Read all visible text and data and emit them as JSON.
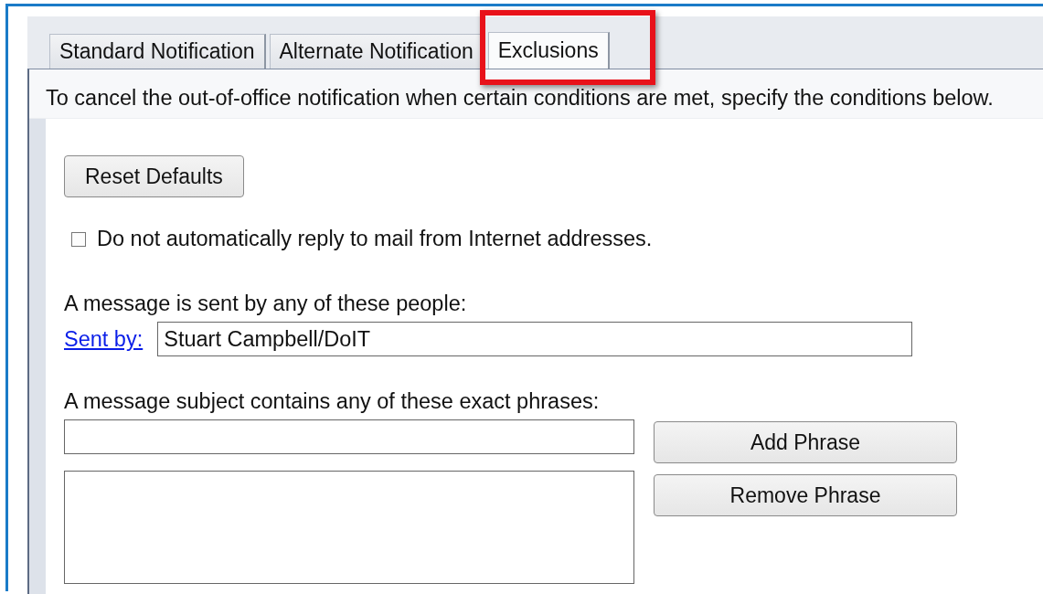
{
  "tabs": [
    {
      "label": "Standard Notification",
      "selected": false,
      "highlighted": false
    },
    {
      "label": "Alternate Notification",
      "selected": false,
      "highlighted": false
    },
    {
      "label": "Exclusions",
      "selected": true,
      "highlighted": true
    }
  ],
  "instruction": "To cancel the out-of-office notification when certain conditions are met, specify the conditions below.",
  "reset_button": "Reset Defaults",
  "internet_checkbox": {
    "label": "Do not automatically reply to mail from Internet addresses.",
    "checked": false
  },
  "sender_section": {
    "label": "A message is sent by any of these people:",
    "link": "Sent by:",
    "value": "Stuart Campbell/DoIT"
  },
  "subject_section": {
    "label": "A message subject contains any of these exact phrases:"
  },
  "buttons": [
    "Add Phrase",
    "Remove Phrase"
  ]
}
